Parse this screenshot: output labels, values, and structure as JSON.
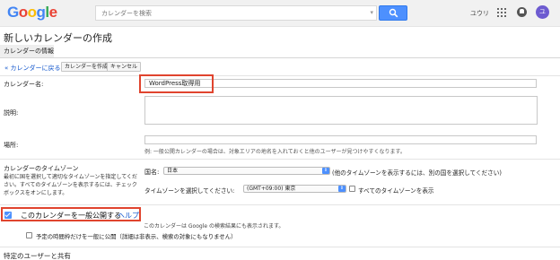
{
  "header": {
    "logo_letters": [
      {
        "char": "G",
        "color": "#4285f4"
      },
      {
        "char": "o",
        "color": "#ea4335"
      },
      {
        "char": "o",
        "color": "#fbbc05"
      },
      {
        "char": "g",
        "color": "#4285f4"
      },
      {
        "char": "l",
        "color": "#34a853"
      },
      {
        "char": "e",
        "color": "#ea4335"
      }
    ],
    "search_placeholder": "カレンダーを検索",
    "search_icon": "search-icon",
    "user_name": "ユウリ",
    "avatar_initial": "ユ",
    "avatar_color": "#6d5bd0",
    "accent_color": "#4d90fe"
  },
  "page": {
    "title": "新しいカレンダーの作成",
    "section_tab": "カレンダーの情報"
  },
  "toolbar": {
    "back_label": "« カレンダーに戻る",
    "create_label": "カレンダーを作成",
    "cancel_label": "キャンセル"
  },
  "form": {
    "name_label": "カレンダー名:",
    "name_value": "WordPress取得用",
    "description_label": "説明:",
    "description_value": "",
    "place_label": "場所:",
    "place_value": "",
    "place_hint": "例: 一般公開カレンダーの場合は、対象エリアの地名を入れておくと他のユーザーが見つけやすくなります。",
    "timezone_label": "カレンダーのタイムゾーン",
    "timezone_description": "最初に国を選択して適切なタイムゾーンを指定してください。すべてのタイムゾーンを表示するには、チェックボックスをオンにします。",
    "country_label": "国名:",
    "country_value": "日本",
    "country_note": "(他のタイムゾーンを表示するには、別の国を選択してください)",
    "timezone_select_label": "タイムゾーンを選択してください:",
    "timezone_value": "(GMT+09:00) 東京",
    "all_timezones_label": "すべてのタイムゾーンを表示",
    "public_label": "このカレンダーを一般公開する",
    "help_label": "ヘルプ",
    "public_note": "このカレンダーは Google の検索結果にも表示されます。",
    "free_busy_label": "予定の時間枠だけを一般に公開（詳細は非表示、検索の対象にもなりません）",
    "public_checked": true,
    "highlight_color": "#e0442e"
  },
  "sharing": {
    "title": "特定のユーザーと共有"
  }
}
